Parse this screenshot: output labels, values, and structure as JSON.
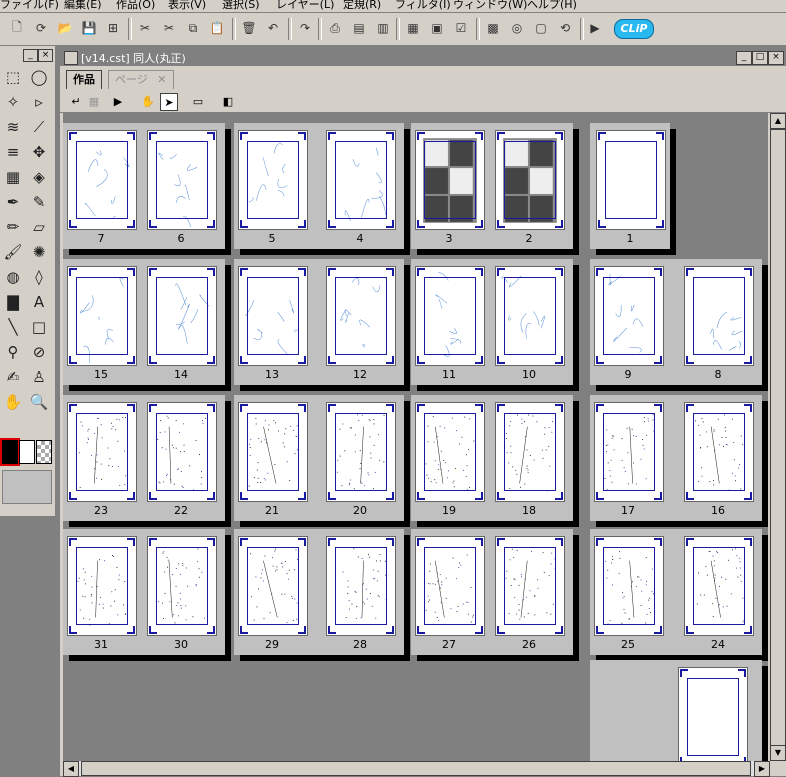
{
  "menubar": [
    "ファイル(F)",
    "編集(E)",
    "作品(O)",
    "表示(V)",
    "選択(S)",
    "レイヤー(L)",
    "定規(R)",
    "フィルタ(I)",
    "ウィンドウ(W)",
    "ヘルプ(H)"
  ],
  "toolbar": {
    "icons": [
      "new-page-icon",
      "new-book-icon",
      "open-icon",
      "save-icon",
      "save-all-icon",
      "delete-icon",
      "cut-icon",
      "copy-icon",
      "paste-icon",
      "clear-icon",
      "undo-icon",
      "redo-icon",
      "print-icon",
      "layer-properties-icon",
      "page-panel-icon",
      "layer-panel-icon",
      "navigator-icon",
      "properties-icon",
      "color-icon",
      "material-icon",
      "canvas-icon",
      "refresh-icon",
      "preview-icon",
      "globe-icon"
    ],
    "logo": "CLiP"
  },
  "palette": {
    "tools": [
      "rect-select-icon",
      "lasso-icon",
      "magic-wand-icon",
      "object-select-icon",
      "layer-move-icon",
      "eyedropper-icon",
      "hand-flip-icon",
      "move-icon",
      "grid-icon",
      "3d-icon",
      "pen-icon",
      "marker-icon",
      "pencil-icon",
      "eraser-icon",
      "brush-icon",
      "airbrush-icon",
      "fill-icon",
      "pattern-icon",
      "gradient-icon",
      "text-icon",
      "line-icon",
      "rectangle-icon",
      "stamp-icon",
      "tone-eraser-icon",
      "ink-icon",
      "stamp2-icon",
      "hand-icon",
      "zoom-icon"
    ],
    "colors": {
      "main": "#000000",
      "sub": "#ffffff",
      "transparent": "transparent"
    }
  },
  "document": {
    "title": "[v14.cst] 同人(丸正)",
    "tabs": [
      "作品",
      "ページ"
    ],
    "active_tab": "作品"
  },
  "spreads": [
    {
      "pages": [
        "7",
        "6"
      ],
      "sketch": "light"
    },
    {
      "pages": [
        "5",
        "4"
      ],
      "sketch": "light"
    },
    {
      "pages": [
        "3",
        "2"
      ],
      "sketch": "manga"
    },
    {
      "pages": [
        "1"
      ],
      "sketch": "blank"
    },
    {
      "pages": [
        "15",
        "14"
      ],
      "sketch": "light"
    },
    {
      "pages": [
        "13",
        "12"
      ],
      "sketch": "light"
    },
    {
      "pages": [
        "11",
        "10"
      ],
      "sketch": "light"
    },
    {
      "pages": [
        "9",
        "8"
      ],
      "sketch": "light"
    },
    {
      "pages": [
        "23",
        "22"
      ],
      "sketch": "dark"
    },
    {
      "pages": [
        "21",
        "20"
      ],
      "sketch": "dark"
    },
    {
      "pages": [
        "19",
        "18"
      ],
      "sketch": "dark"
    },
    {
      "pages": [
        "17",
        "16"
      ],
      "sketch": "dark"
    },
    {
      "pages": [
        "31",
        "30"
      ],
      "sketch": "dark"
    },
    {
      "pages": [
        "29",
        "28"
      ],
      "sketch": "dark"
    },
    {
      "pages": [
        "27",
        "26"
      ],
      "sketch": "dark"
    },
    {
      "pages": [
        "25",
        "24"
      ],
      "sketch": "dark"
    },
    {
      "pages": [
        ""
      ],
      "sketch": "blank"
    }
  ]
}
